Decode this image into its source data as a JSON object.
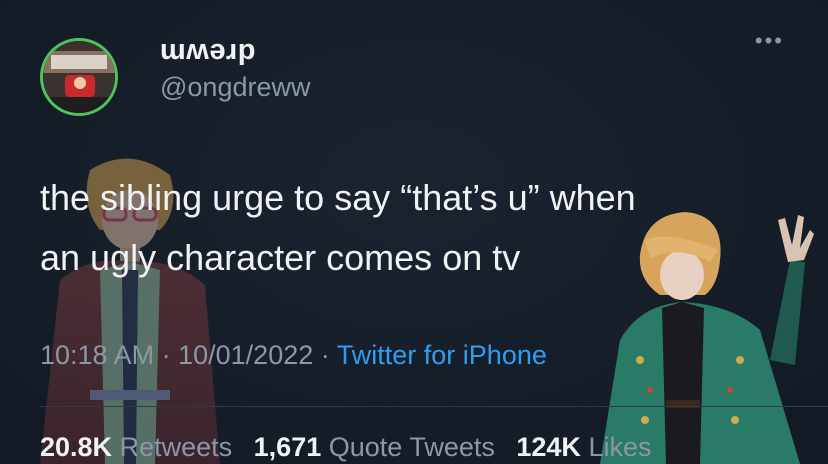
{
  "tweet": {
    "display_name": "ɯʍǝɹp",
    "handle": "@ongdreww",
    "more_icon": "more-horizontal-icon",
    "text": "the sibling urge to say “that’s u” when\nan ugly character comes on tv",
    "time": "10:18 AM",
    "separator_1": "·",
    "date": "10/01/2022",
    "separator_2": "·",
    "source": "Twitter for iPhone",
    "stats": {
      "retweets_count": "20.8K",
      "retweets_label": "Retweets",
      "quote_count": "1,671",
      "quote_label": "Quote Tweets",
      "likes_count": "124K",
      "likes_label": "Likes"
    }
  },
  "colors": {
    "background": "#151d28",
    "link": "#2f9ef0",
    "avatar_ring": "#4cc65a",
    "muted_text": "#8b98a5"
  }
}
